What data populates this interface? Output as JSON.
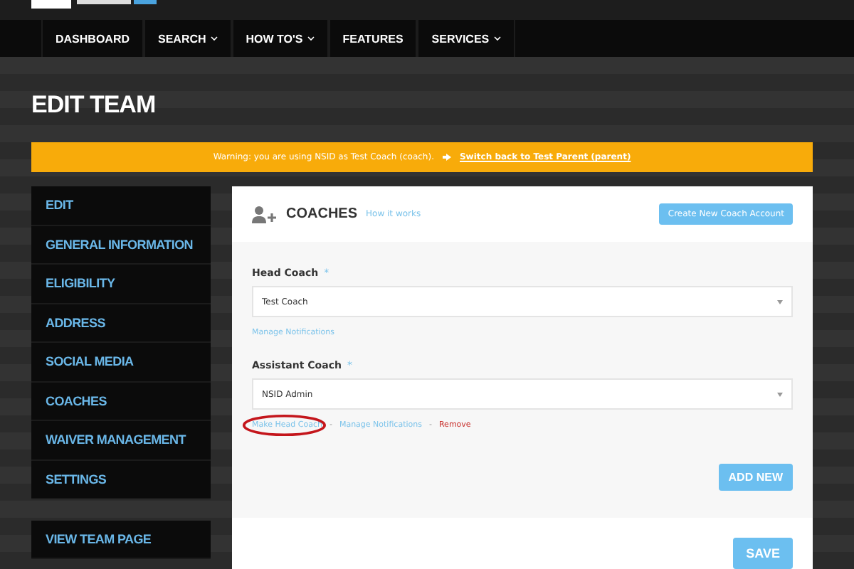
{
  "nav": [
    {
      "label": "DASHBOARD",
      "has_menu": false
    },
    {
      "label": "SEARCH",
      "has_menu": true
    },
    {
      "label": "HOW TO'S",
      "has_menu": true
    },
    {
      "label": "FEATURES",
      "has_menu": false
    },
    {
      "label": "SERVICES",
      "has_menu": true
    }
  ],
  "page_title": "EDIT TEAM",
  "warning": {
    "text": "Warning: you are using NSID as Test Coach (coach).",
    "link": "Switch back to Test Parent (parent)"
  },
  "sidebar": {
    "items": [
      {
        "label": "EDIT"
      },
      {
        "label": "GENERAL INFORMATION"
      },
      {
        "label": "ELIGIBILITY"
      },
      {
        "label": "ADDRESS"
      },
      {
        "label": "SOCIAL MEDIA"
      },
      {
        "label": "COACHES"
      },
      {
        "label": "WAIVER MANAGEMENT"
      },
      {
        "label": "SETTINGS"
      }
    ],
    "extra": {
      "label": "VIEW TEAM PAGE"
    }
  },
  "panel": {
    "title": "COACHES",
    "help_link": "How it works",
    "create_button": "Create New Coach Account",
    "separator": "-",
    "fields": [
      {
        "label": "Head Coach",
        "required_mark": "*",
        "value": "Test Coach",
        "actions": [
          {
            "label": "Manage Notifications",
            "kind": "link",
            "circled": false
          }
        ]
      },
      {
        "label": "Assistant Coach",
        "required_mark": "*",
        "value": "NSID Admin",
        "actions": [
          {
            "label": "Make Head Coach",
            "kind": "link",
            "circled": true
          },
          {
            "label": "Manage Notifications",
            "kind": "link",
            "circled": false
          },
          {
            "label": "Remove",
            "kind": "danger",
            "circled": false
          }
        ]
      }
    ],
    "add_button": "ADD NEW",
    "save_button": "SAVE"
  }
}
